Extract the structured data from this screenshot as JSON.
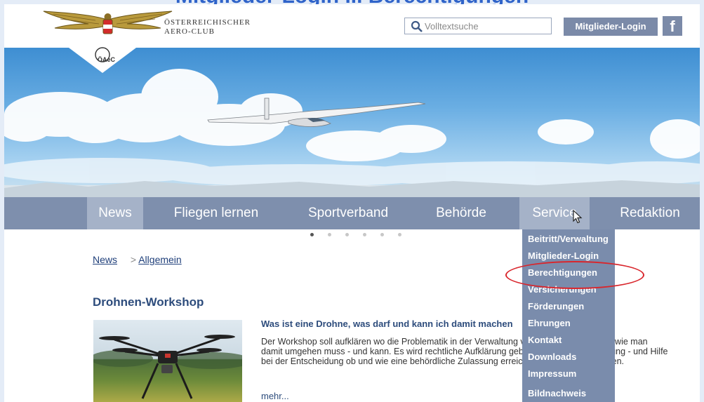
{
  "slide_title": "Mitglieder-Login ... Berechtigungen",
  "header": {
    "club_name_line1": "ÖSTERREICHISCHER",
    "club_name_line2": "AERO-CLUB",
    "logo_badge": "ÖAeC",
    "search_placeholder": "Volltextsuche",
    "login_label": "Mitglieder-Login",
    "facebook_label": "f"
  },
  "nav": {
    "items": [
      {
        "label": "News",
        "state": "active"
      },
      {
        "label": "Fliegen lernen",
        "state": "normal"
      },
      {
        "label": "Sportverband",
        "state": "normal"
      },
      {
        "label": "Behörde",
        "state": "normal"
      },
      {
        "label": "Service",
        "state": "hover"
      },
      {
        "label": "Redaktion",
        "state": "normal"
      }
    ]
  },
  "slider": {
    "total": 6,
    "active_index": 0
  },
  "breadcrumb": {
    "home": "News",
    "separator": ">",
    "current": "Allgemein"
  },
  "article": {
    "title": "Drohnen-Workshop",
    "headline": "Was ist eine Drohne, was darf und kann ich damit machen",
    "body": "Der Workshop soll aufklären wo die Problematik in der Verwaltung von \"Drohnen\" liegt und wie man damit umgehen muss - und kann. Es wird rechtliche Aufklärung geboten, technische Beratung - und Hilfe bei der Entscheidung ob und wie eine behördliche Zulassung erreicht werden kann, gegeben.",
    "more": "mehr..."
  },
  "service_menu": {
    "items": [
      "Beitritt/Verwaltung",
      "Mitglieder-Login",
      "Berechtigungen",
      "Versicherungen",
      "Förderungen",
      "Ehrungen",
      "Kontakt",
      "Downloads",
      "Impressum",
      "Bildnachweis"
    ],
    "highlighted": "Berechtigungen"
  },
  "colors": {
    "nav_bg": "#7e8fad",
    "nav_active": "#a5b2c8",
    "dropdown_bg": "#7a8cac",
    "link": "#2d4c7c",
    "highlight_circle": "#d9262c"
  }
}
